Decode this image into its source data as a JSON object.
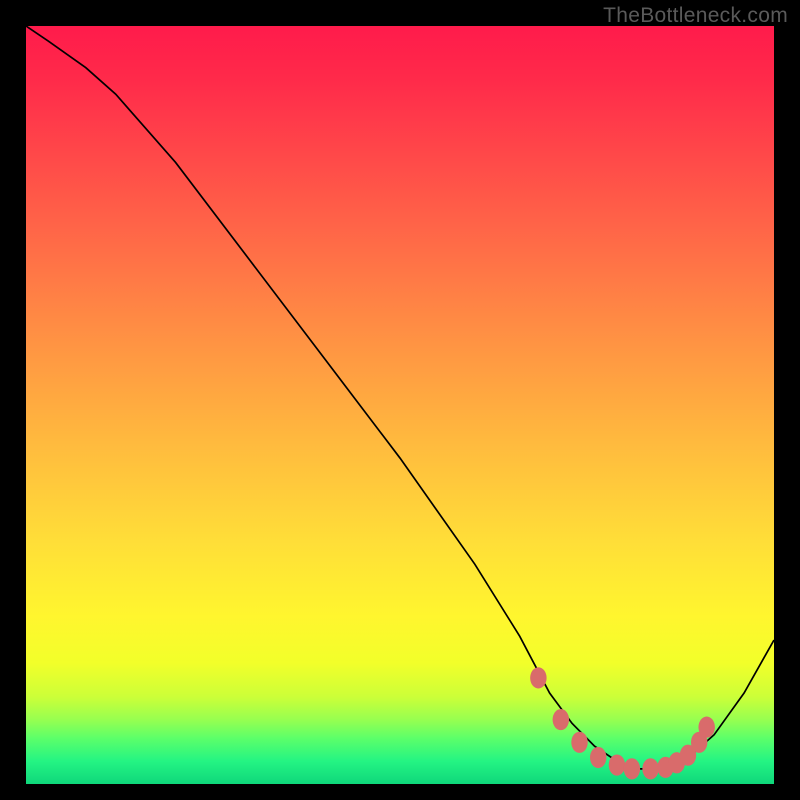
{
  "watermark": "TheBottleneck.com",
  "chart_data": {
    "type": "line",
    "title": "",
    "xlabel": "",
    "ylabel": "",
    "xlim": [
      0,
      100
    ],
    "ylim": [
      0,
      100
    ],
    "series": [
      {
        "name": "curve",
        "x": [
          0,
          3,
          8,
          12,
          20,
          30,
          40,
          50,
          60,
          66,
          70,
          73,
          76,
          79,
          82,
          85,
          88,
          92,
          96,
          100
        ],
        "y": [
          100,
          98,
          94.5,
          91,
          82,
          69,
          56,
          43,
          29,
          19.5,
          12,
          8,
          5,
          3,
          2,
          2,
          3,
          6.5,
          12,
          19
        ]
      }
    ],
    "markers": {
      "name": "dotted-range",
      "color": "#d96b6b",
      "points": [
        {
          "x": 68.5,
          "y": 14
        },
        {
          "x": 71.5,
          "y": 8.5
        },
        {
          "x": 74.0,
          "y": 5.5
        },
        {
          "x": 76.5,
          "y": 3.5
        },
        {
          "x": 79.0,
          "y": 2.5
        },
        {
          "x": 81.0,
          "y": 2.0
        },
        {
          "x": 83.5,
          "y": 2.0
        },
        {
          "x": 85.5,
          "y": 2.2
        },
        {
          "x": 87.0,
          "y": 2.8
        },
        {
          "x": 88.5,
          "y": 3.8
        },
        {
          "x": 90.0,
          "y": 5.5
        },
        {
          "x": 91.0,
          "y": 7.5
        }
      ]
    },
    "gradient_stops": [
      {
        "offset": 0,
        "color": "#ff1b4b"
      },
      {
        "offset": 0.07,
        "color": "#ff2a4a"
      },
      {
        "offset": 0.18,
        "color": "#ff4b49"
      },
      {
        "offset": 0.3,
        "color": "#ff6f47"
      },
      {
        "offset": 0.42,
        "color": "#ff9443"
      },
      {
        "offset": 0.55,
        "color": "#ffba3e"
      },
      {
        "offset": 0.68,
        "color": "#ffde38"
      },
      {
        "offset": 0.78,
        "color": "#fff62e"
      },
      {
        "offset": 0.84,
        "color": "#f2ff2a"
      },
      {
        "offset": 0.885,
        "color": "#ccff38"
      },
      {
        "offset": 0.915,
        "color": "#97ff50"
      },
      {
        "offset": 0.94,
        "color": "#5bff6a"
      },
      {
        "offset": 0.97,
        "color": "#24f483"
      },
      {
        "offset": 1.0,
        "color": "#0fd77b"
      }
    ]
  }
}
